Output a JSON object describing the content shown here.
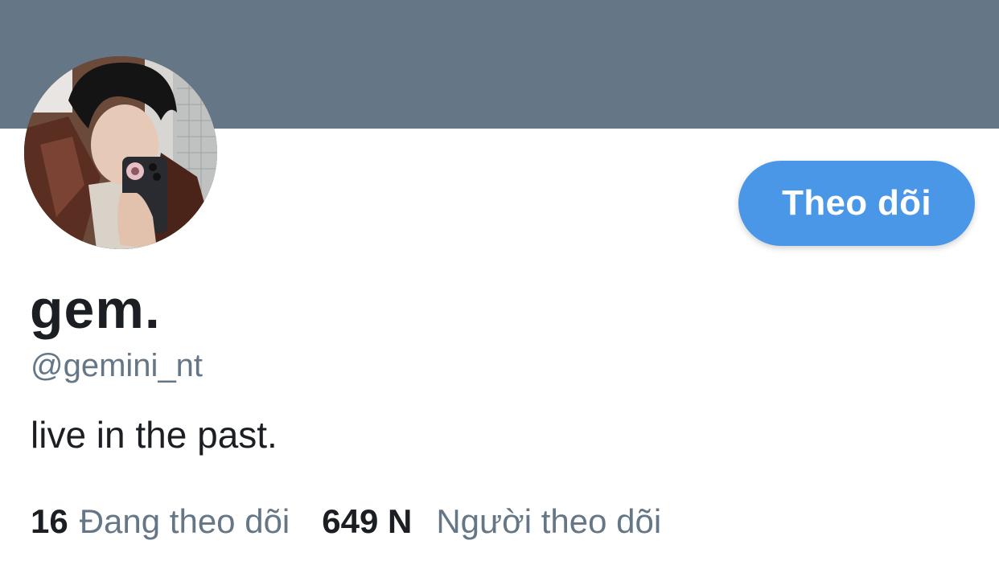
{
  "profile": {
    "display_name": "gem.",
    "handle": "@gemini_nt",
    "bio": "live in the past.",
    "avatar_icon": "user-avatar-photo"
  },
  "actions": {
    "follow_label": "Theo dõi"
  },
  "stats": {
    "following_count": "16",
    "following_label": "Đang theo dõi",
    "followers_count": "649 N",
    "followers_label": "Người theo dõi"
  },
  "colors": {
    "banner": "#657786",
    "accent": "#4a97e8",
    "text_primary": "#1b1f23",
    "text_secondary": "#657786",
    "background": "#ffffff"
  }
}
